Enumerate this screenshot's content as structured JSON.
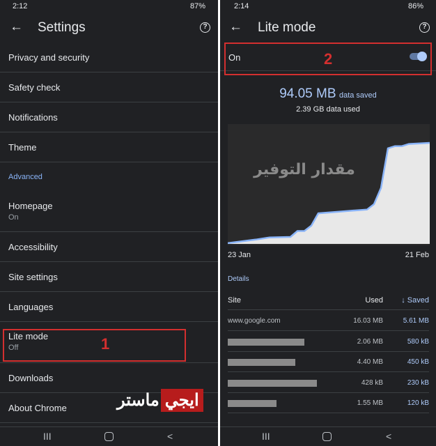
{
  "left": {
    "status": {
      "time": "2:12",
      "battery": "87%"
    },
    "title": "Settings",
    "items": [
      {
        "label": "Privacy and security"
      },
      {
        "label": "Safety check"
      },
      {
        "label": "Notifications"
      },
      {
        "label": "Theme"
      },
      {
        "label": "Homepage",
        "sub": "On"
      },
      {
        "label": "Accessibility"
      },
      {
        "label": "Site settings"
      },
      {
        "label": "Languages"
      },
      {
        "label": "Lite mode",
        "sub": "Off"
      },
      {
        "label": "Downloads"
      },
      {
        "label": "About Chrome"
      }
    ],
    "section_header": "Advanced",
    "annotation": "1",
    "watermark": {
      "part1": "ايجي",
      "part2": "ماستر"
    }
  },
  "right": {
    "status": {
      "time": "2:14",
      "battery": "86%"
    },
    "title": "Lite mode",
    "toggle": {
      "label": "On",
      "checked": true
    },
    "annotation": "2",
    "saved": "94.05 MB",
    "saved_suffix": "data saved",
    "used": "2.39 GB data used",
    "chart_watermark": "مقدار التوفير",
    "details_label": "Details",
    "table": {
      "headers": {
        "site": "Site",
        "used": "Used",
        "saved": "↓ Saved"
      },
      "rows": [
        {
          "site": "www.google.com",
          "used": "16.03 MB",
          "saved": "5.61 MB",
          "redacted": false
        },
        {
          "site": "",
          "used": "2.06 MB",
          "saved": "580 kB",
          "redacted": true
        },
        {
          "site": "",
          "used": "4.40 MB",
          "saved": "450 kB",
          "redacted": true
        },
        {
          "site": "",
          "used": "428 kB",
          "saved": "230 kB",
          "redacted": true
        },
        {
          "site": "",
          "used": "1.55 MB",
          "saved": "120 kB",
          "redacted": true
        }
      ]
    }
  },
  "colors": {
    "background": "#202124",
    "accent": "#8ab4f8",
    "annotation": "#d32f2f",
    "area_fill": "#e8e8e8"
  },
  "chart_data": {
    "type": "area",
    "x_start_label": "23 Jan",
    "x_end_label": "21 Feb",
    "unit": "MB",
    "x": [
      "23 Jan",
      "27 Jan",
      "29 Jan",
      "1 Feb",
      "2 Feb",
      "3 Feb",
      "4 Feb",
      "5 Feb",
      "8 Feb",
      "12 Feb",
      "13 Feb",
      "14 Feb",
      "15 Feb",
      "16 Feb",
      "17 Feb",
      "18 Feb",
      "21 Feb"
    ],
    "values": [
      0.7,
      4,
      6,
      6.5,
      12,
      12,
      17,
      28.5,
      30,
      32,
      37,
      52,
      89,
      91,
      91,
      93,
      94.05
    ],
    "grid": false
  }
}
